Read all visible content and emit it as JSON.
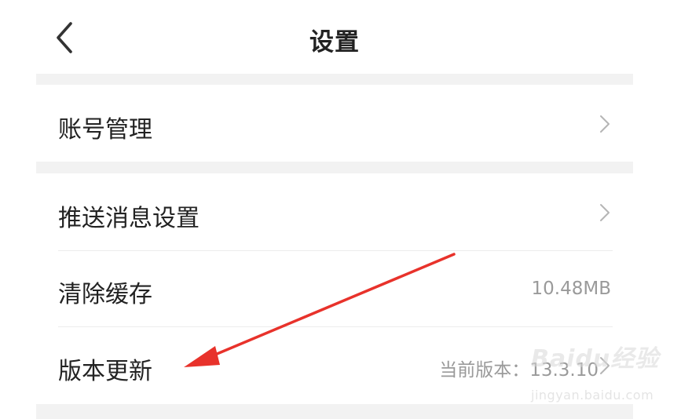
{
  "header": {
    "title": "设置",
    "back_icon": "chevron-left-icon"
  },
  "settings": {
    "account": {
      "label": "账号管理",
      "icon": "chevron-right-icon"
    },
    "push": {
      "label": "推送消息设置",
      "icon": "chevron-right-icon"
    },
    "cache": {
      "label": "清除缓存",
      "value": "10.48MB"
    },
    "version": {
      "label": "版本更新",
      "value": "当前版本：13.3.10",
      "icon": "chevron-right-icon"
    }
  },
  "annotation": {
    "color": "#e8322b"
  },
  "watermark": {
    "logo": "Baidu经验",
    "url": "jingyan.baidu.com"
  },
  "colors": {
    "separator": "#f2f2f2",
    "text_primary": "#222222",
    "text_secondary": "#9a9a9a"
  }
}
